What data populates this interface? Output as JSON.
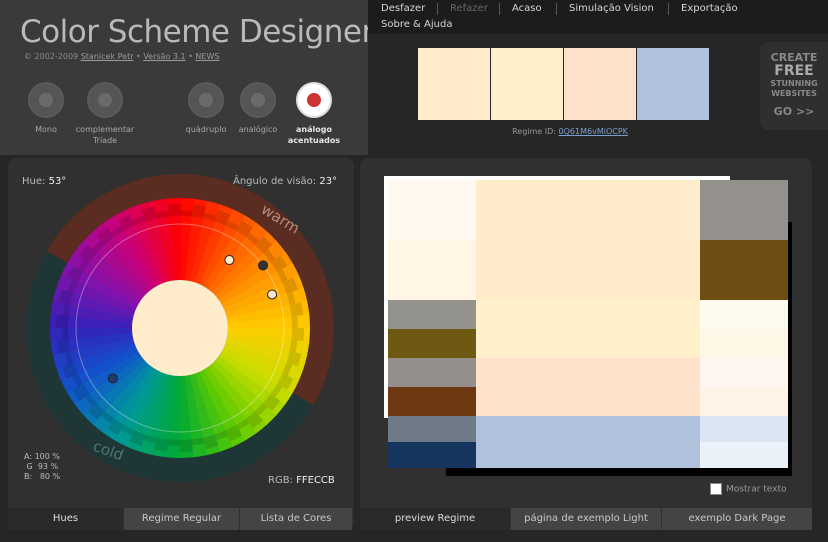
{
  "app": {
    "title": "Color Scheme Designer",
    "copyright_prefix": "© 2002-2009",
    "author": "Stanicek Petr",
    "dot1": "•",
    "version": "Versão 3.1",
    "dot2": "•",
    "news": "NEWS"
  },
  "menu": {
    "undo": "Desfazer",
    "redo": "Refazer",
    "random": "Acaso",
    "vision": "Simulação Vision",
    "export": "Exportação",
    "about": "Sobre & Ajuda"
  },
  "schemes": [
    {
      "label": "Mono",
      "active": false
    },
    {
      "label": "complementar Tríade",
      "active": false
    },
    {
      "label": "quádruplo",
      "active": false
    },
    {
      "label": "analógico",
      "active": false
    },
    {
      "label": "análogo acentuados",
      "active": true
    }
  ],
  "palette": {
    "swatches": [
      "#FFECCB",
      "#FFF0CB",
      "#FFE2CB",
      "#B0C2DB"
    ],
    "regime_label": "Regime ID:",
    "regime_id": "0Q61M6vMiOCPK"
  },
  "ad": {
    "line1": "CREATE",
    "line2": "FREE",
    "line3": "STUNNING",
    "line4": "WEBSITES",
    "cta": "GO >>"
  },
  "wheel": {
    "hue_label": "Hue:",
    "hue_value": "53°",
    "angle_label": "Ângulo de visão:",
    "angle_value": "23°",
    "warm_label": "warm",
    "cold_label": "cold",
    "center_color": "#FFECCB",
    "a_label": "A:",
    "a_value": "100 %",
    "g_label": "G",
    "g_value": "93 %",
    "b_label": "B:",
    "b_value": "80 %",
    "rgb_label": "RGB:",
    "rgb_value": "FFECCB"
  },
  "left_tabs": {
    "hues": "Hues",
    "regular": "Regime Regular",
    "list": "Lista de Cores"
  },
  "right_tabs": {
    "preview": "preview Regime",
    "light": "página de exemplo Light",
    "dark": "exemplo Dark Page"
  },
  "preview": {
    "show_text": "Mostrar texto",
    "colors": {
      "primary": [
        "#FFECCB",
        "#FFF9EF",
        "#FFF6E6",
        "#94918C",
        "#6E4D13"
      ],
      "secondary_a": [
        "#FFF0CB",
        "#FFFAEF",
        "#FFF7E6",
        "#94928C",
        "#6E5913"
      ],
      "secondary_b": [
        "#FFE2CB",
        "#FFF6EF",
        "#FFF2E6",
        "#948F8C",
        "#6E3813"
      ],
      "complement": [
        "#B0C2DB",
        "#EBF1F9",
        "#DCE6F3",
        "#6F7A88",
        "#16355F"
      ]
    }
  }
}
